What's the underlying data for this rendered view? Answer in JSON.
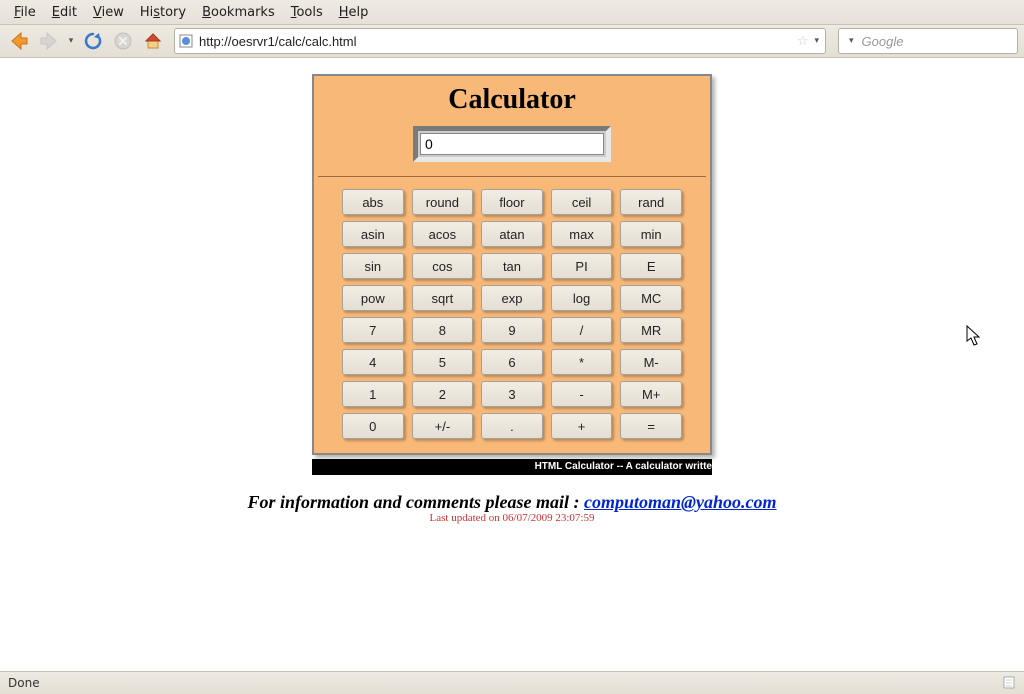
{
  "menubar": {
    "items": [
      "File",
      "Edit",
      "View",
      "History",
      "Bookmarks",
      "Tools",
      "Help"
    ]
  },
  "toolbar": {
    "url": "http://oesrvr1/calc/calc.html",
    "search_placeholder": "Google"
  },
  "calculator": {
    "title": "Calculator",
    "display_value": "0",
    "rows": [
      [
        "abs",
        "round",
        "floor",
        "ceil",
        "rand"
      ],
      [
        "asin",
        "acos",
        "atan",
        "max",
        "min"
      ],
      [
        "sin",
        "cos",
        "tan",
        "PI",
        "E"
      ],
      [
        "pow",
        "sqrt",
        "exp",
        "log",
        "MC"
      ],
      [
        "7",
        "8",
        "9",
        "/",
        "MR"
      ],
      [
        "4",
        "5",
        "6",
        "*",
        "M-"
      ],
      [
        "1",
        "2",
        "3",
        "-",
        "M+"
      ],
      [
        "0",
        "+/-",
        ".",
        "+",
        "="
      ]
    ]
  },
  "marquee_text": "HTML Calculator -- A calculator writte",
  "info": {
    "prefix": "For information and comments please mail : ",
    "email": "computoman@yahoo.com"
  },
  "updated": "Last updated on 06/07/2009 23:07:59",
  "status": {
    "text": "Done"
  }
}
